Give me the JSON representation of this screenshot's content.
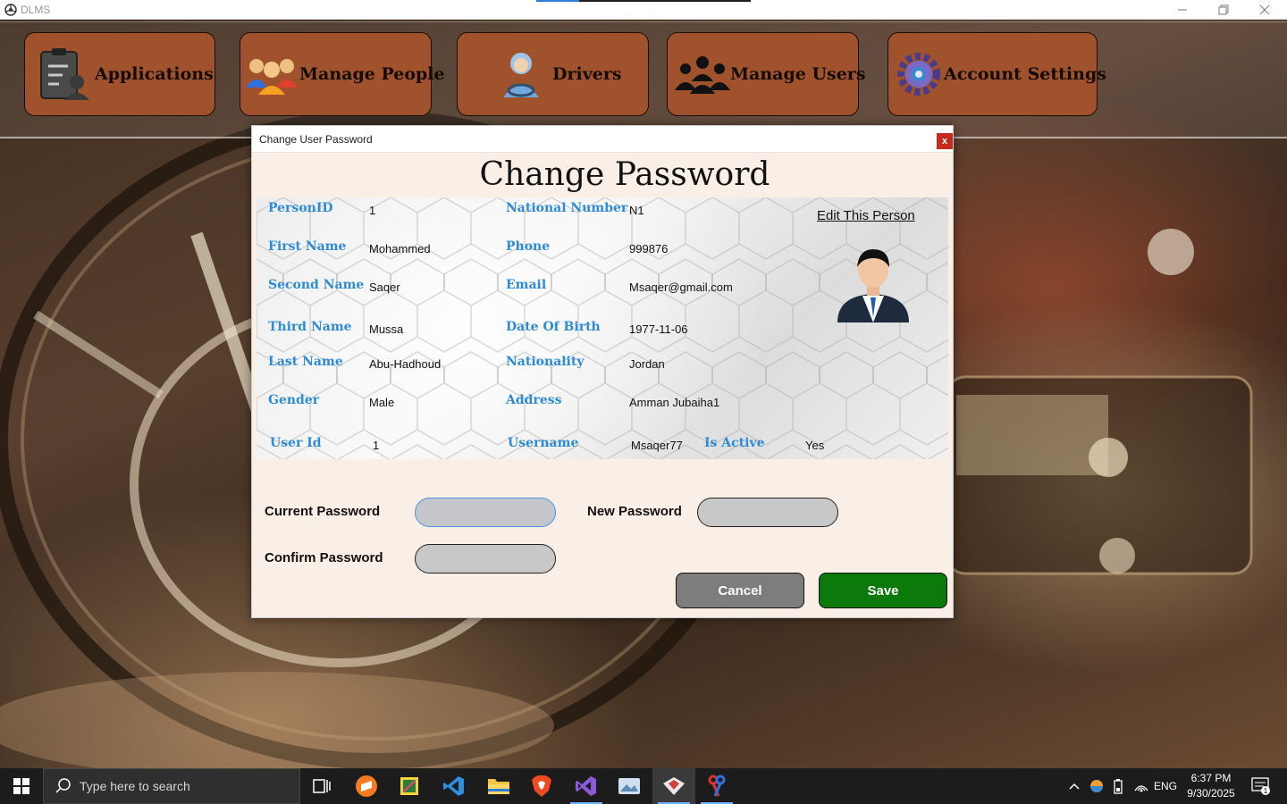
{
  "window": {
    "title": "DLMS"
  },
  "menu": {
    "applications": "Applications",
    "manage_people": "Manage People",
    "drivers": "Drivers",
    "manage_users": "Manage Users",
    "account_settings": "Account Settings"
  },
  "dialog": {
    "title": "Change User Password",
    "close": "x",
    "heading": "Change Password",
    "edit_link": "Edit This Person",
    "labels": {
      "person_id": "PersonID",
      "first_name": "First Name",
      "second_name": "Second Name",
      "third_name": "Third Name",
      "last_name": "Last Name",
      "gender": "Gender",
      "national_number": "National Number",
      "phone": "Phone",
      "email": "Email",
      "date_of_birth": "Date Of Birth",
      "nationality": "Nationality",
      "address": "Address",
      "user_id": "User Id",
      "username": "Username",
      "is_active": "Is Active"
    },
    "values": {
      "person_id": "1",
      "first_name": "Mohammed",
      "second_name": "Saqer",
      "third_name": "Mussa",
      "last_name": "Abu-Hadhoud",
      "gender": "Male",
      "national_number": "N1",
      "phone": "999876",
      "email": "Msaqer@gmail.com",
      "date_of_birth": "1977-11-06",
      "nationality": "Jordan",
      "address": "Amman Jubaiha1",
      "user_id": "1",
      "username": "Msaqer77",
      "is_active": "Yes"
    },
    "password": {
      "current_label": "Current Password",
      "new_label": "New Password",
      "confirm_label": "Confirm Password",
      "current_value": "",
      "new_value": "",
      "confirm_value": ""
    },
    "buttons": {
      "cancel": "Cancel",
      "save": "Save"
    }
  },
  "taskbar": {
    "search_placeholder": "Type here to search",
    "language": "ENG",
    "time": "6:37 PM",
    "date": "9/30/2025",
    "notification_count": "1"
  },
  "colors": {
    "menu_button": "#a0522d",
    "label_blue": "#2e8bd6",
    "save_green": "#0b7a0b",
    "cancel_gray": "#7d7d7d",
    "dialog_bg": "#f9efe6"
  }
}
